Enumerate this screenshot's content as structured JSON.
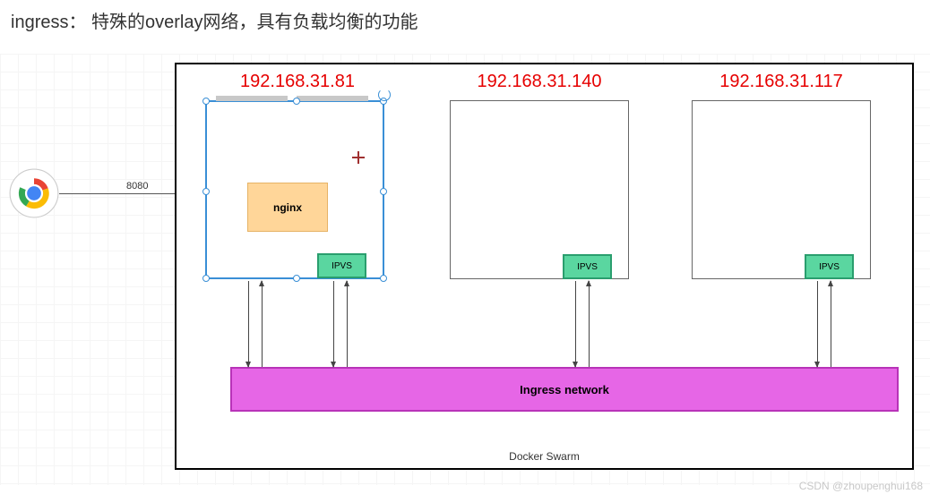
{
  "title": "ingress： 特殊的overlay网络，具有负载均衡的功能",
  "port_label": "8080",
  "swarm_label": "Docker Swarm",
  "ingress_label": "Ingress network",
  "nodes": [
    {
      "ip": "192.168.31.81",
      "selected": true,
      "has_nginx": true,
      "nginx_label": "nginx",
      "ipvs_label": "IPVS"
    },
    {
      "ip": "192.168.31.140",
      "selected": false,
      "has_nginx": false,
      "ipvs_label": "IPVS"
    },
    {
      "ip": "192.168.31.117",
      "selected": false,
      "has_nginx": false,
      "ipvs_label": "IPVS"
    }
  ],
  "watermark": "CSDN @zhoupenghui168",
  "chart_data": {
    "type": "diagram",
    "description": "Chrome client connects on port 8080 to a Docker Swarm cluster. Three nodes (192.168.31.81 with nginx, 192.168.31.140, 192.168.31.117) each run IPVS, which bidirectionally connects to an Ingress overlay network providing load balancing.",
    "edges": [
      {
        "from": "chrome",
        "to": "node-81",
        "label": "8080"
      },
      {
        "from": "node-81-ipvs",
        "to": "ingress-network",
        "bidir": true
      },
      {
        "from": "node-140-ipvs",
        "to": "ingress-network",
        "bidir": true
      },
      {
        "from": "node-117-ipvs",
        "to": "ingress-network",
        "bidir": true
      }
    ]
  }
}
